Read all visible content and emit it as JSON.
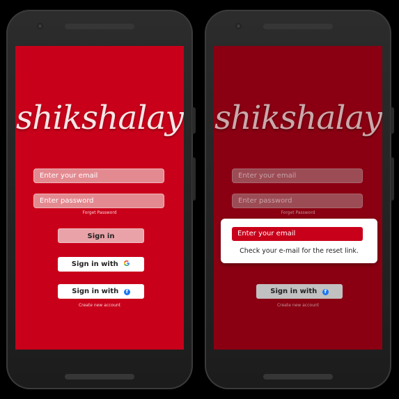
{
  "app": {
    "logo_text": "shikshalay"
  },
  "login": {
    "email_placeholder": "Enter your email",
    "password_placeholder": "Enter  password",
    "forgot_label": "Forget Password",
    "signin_label": "Sign in",
    "google_label": "Sign in with",
    "facebook_label": "Sign in with",
    "create_label": "Create new account"
  },
  "reset_dialog": {
    "email_label": "Enter your email",
    "message": "Check your e-mail for the reset link."
  },
  "colors": {
    "brand_red": "#c9001a",
    "dimmed_red": "#8a0012"
  },
  "icons": {
    "google": "google-icon",
    "facebook": "facebook-icon"
  }
}
